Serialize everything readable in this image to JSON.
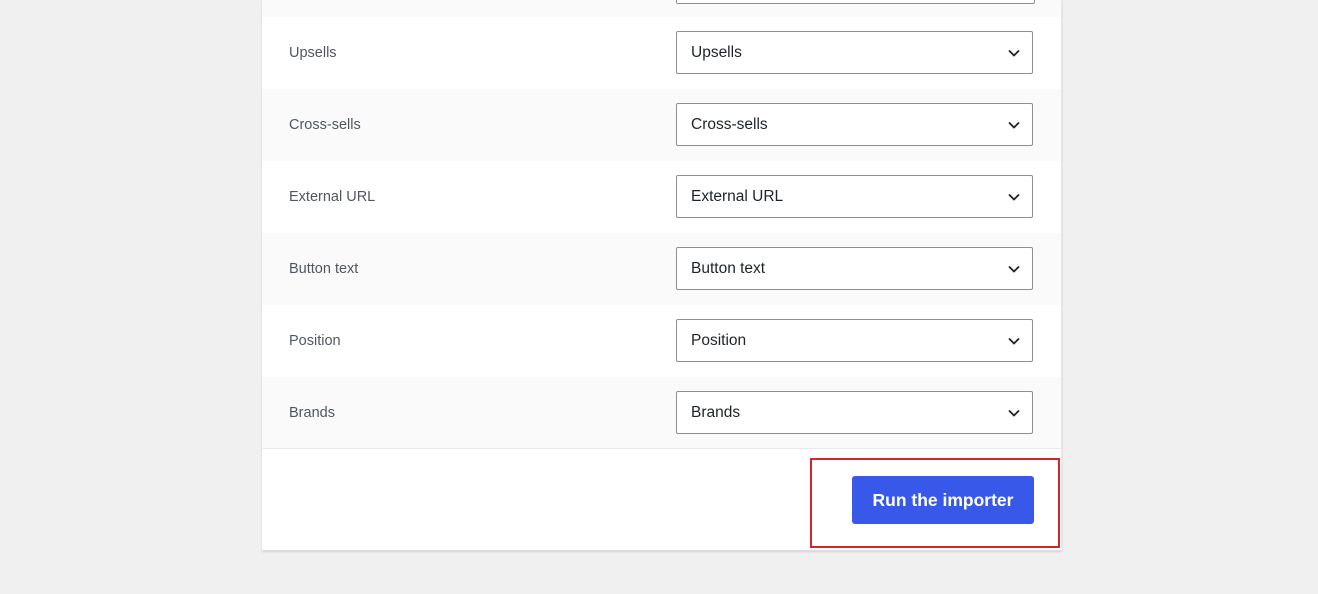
{
  "mapping_rows": [
    {
      "label": "Upsells",
      "value": "Upsells"
    },
    {
      "label": "Cross-sells",
      "value": "Cross-sells"
    },
    {
      "label": "External URL",
      "value": "External URL"
    },
    {
      "label": "Button text",
      "value": "Button text"
    },
    {
      "label": "Position",
      "value": "Position"
    },
    {
      "label": "Brands",
      "value": "Brands"
    }
  ],
  "icons": {
    "dropdown": "chevron-down-icon"
  },
  "footer": {
    "run_button_label": "Run the importer"
  },
  "colors": {
    "primary_button": "#3858e9",
    "highlight": "#d0262f",
    "background": "#f0f0f1"
  }
}
